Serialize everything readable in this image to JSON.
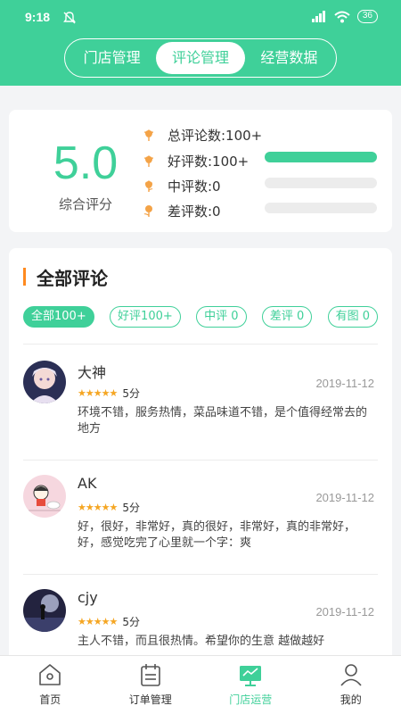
{
  "status_bar": {
    "time": "9:18",
    "battery": "36"
  },
  "segment": {
    "tabs": [
      {
        "label": "门店管理"
      },
      {
        "label": "评论管理"
      },
      {
        "label": "经营数据"
      }
    ],
    "active_index": 1
  },
  "summary": {
    "score": "5.0",
    "score_label": "综合评分",
    "rows": [
      {
        "text": "总评论数:100+",
        "fill": null
      },
      {
        "text": "好评数:100+",
        "fill": 1.0
      },
      {
        "text": "中评数:0",
        "fill": 0.0
      },
      {
        "text": "差评数:0",
        "fill": 0.0
      }
    ],
    "accent": "#3fd099"
  },
  "reviews_section": {
    "title": "全部评论",
    "filters": [
      {
        "label": "全部100+"
      },
      {
        "label": "好评100+"
      },
      {
        "label": "中评 0"
      },
      {
        "label": "差评 0"
      },
      {
        "label": "有图 0"
      }
    ],
    "active_filter": 0,
    "items": [
      {
        "name": "大神",
        "stars": 5,
        "score": "5分",
        "date": "2019-11-12",
        "text": "环境不错，服务热情，菜品味道不错，是个值得经常去的地方"
      },
      {
        "name": "AK",
        "stars": 5,
        "score": "5分",
        "date": "2019-11-12",
        "text": "好，很好，非常好，真的很好，非常好，真的非常好，好，感觉吃完了心里就一个字：爽"
      },
      {
        "name": "cjy",
        "stars": 5,
        "score": "5分",
        "date": "2019-11-12",
        "text": "主人不错，而且很热情。希望你的生意  越做越好"
      }
    ]
  },
  "tabbar": {
    "items": [
      {
        "label": "首页",
        "icon": "home-icon"
      },
      {
        "label": "订单管理",
        "icon": "order-icon"
      },
      {
        "label": "门店运营",
        "icon": "store-operation-icon"
      },
      {
        "label": "我的",
        "icon": "profile-icon"
      }
    ],
    "active_index": 2
  }
}
